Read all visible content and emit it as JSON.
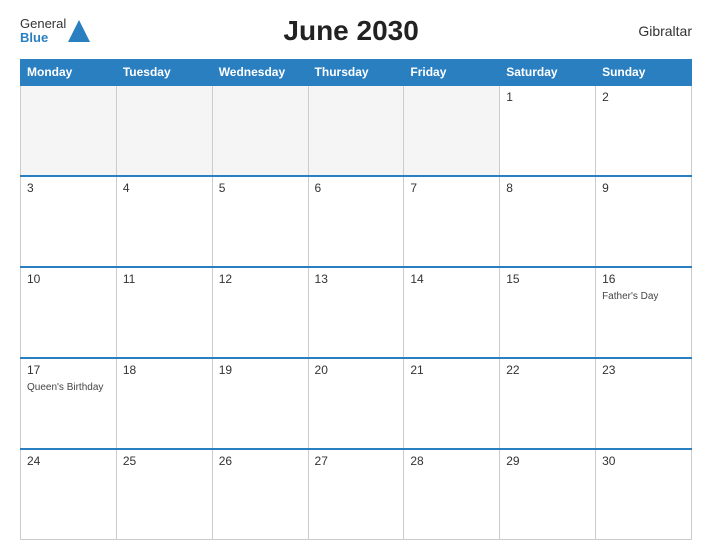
{
  "header": {
    "title": "June 2030",
    "region": "Gibraltar",
    "logo_general": "General",
    "logo_blue": "Blue"
  },
  "weekdays": [
    "Monday",
    "Tuesday",
    "Wednesday",
    "Thursday",
    "Friday",
    "Saturday",
    "Sunday"
  ],
  "weeks": [
    [
      {
        "day": "",
        "empty": true
      },
      {
        "day": "",
        "empty": true
      },
      {
        "day": "",
        "empty": true
      },
      {
        "day": "",
        "empty": true
      },
      {
        "day": "",
        "empty": true
      },
      {
        "day": "1",
        "event": ""
      },
      {
        "day": "2",
        "event": ""
      }
    ],
    [
      {
        "day": "3",
        "event": ""
      },
      {
        "day": "4",
        "event": ""
      },
      {
        "day": "5",
        "event": ""
      },
      {
        "day": "6",
        "event": ""
      },
      {
        "day": "7",
        "event": ""
      },
      {
        "day": "8",
        "event": ""
      },
      {
        "day": "9",
        "event": ""
      }
    ],
    [
      {
        "day": "10",
        "event": ""
      },
      {
        "day": "11",
        "event": ""
      },
      {
        "day": "12",
        "event": ""
      },
      {
        "day": "13",
        "event": ""
      },
      {
        "day": "14",
        "event": ""
      },
      {
        "day": "15",
        "event": ""
      },
      {
        "day": "16",
        "event": "Father's Day"
      }
    ],
    [
      {
        "day": "17",
        "event": "Queen's Birthday"
      },
      {
        "day": "18",
        "event": ""
      },
      {
        "day": "19",
        "event": ""
      },
      {
        "day": "20",
        "event": ""
      },
      {
        "day": "21",
        "event": ""
      },
      {
        "day": "22",
        "event": ""
      },
      {
        "day": "23",
        "event": ""
      }
    ],
    [
      {
        "day": "24",
        "event": ""
      },
      {
        "day": "25",
        "event": ""
      },
      {
        "day": "26",
        "event": ""
      },
      {
        "day": "27",
        "event": ""
      },
      {
        "day": "28",
        "event": ""
      },
      {
        "day": "29",
        "event": ""
      },
      {
        "day": "30",
        "event": ""
      }
    ]
  ]
}
